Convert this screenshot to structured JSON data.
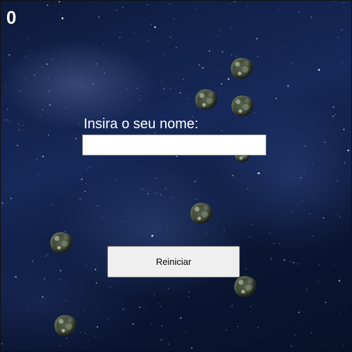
{
  "hud": {
    "score": "0"
  },
  "form": {
    "name_label": "Insira o seu nome:",
    "name_value": "",
    "name_placeholder": ""
  },
  "actions": {
    "restart_label": "Reiniciar"
  },
  "scene": {
    "background": "starfield",
    "asteroid_count": 9,
    "colors": {
      "space_dark": "#07112a",
      "space_mid": "#16295a",
      "asteroid": "#4a5340",
      "text": "#ffffff"
    }
  }
}
